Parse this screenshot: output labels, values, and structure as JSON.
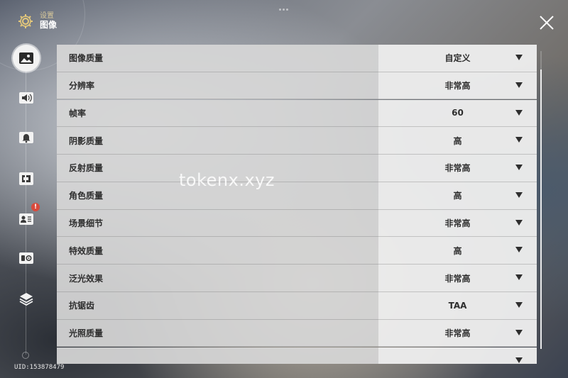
{
  "header": {
    "subtitle": "设置",
    "title": "图像",
    "settings_icon": "gear-icon"
  },
  "close_icon": "close-icon",
  "sidebar": {
    "items": [
      {
        "icon": "image-icon",
        "active": true
      },
      {
        "icon": "speaker-icon",
        "active": false
      },
      {
        "icon": "bell-icon",
        "active": false
      },
      {
        "icon": "controller-icon",
        "active": false
      },
      {
        "icon": "profile-card-icon",
        "active": false,
        "badge": "!"
      },
      {
        "icon": "gear-gamepad-icon",
        "active": false
      },
      {
        "icon": "layers-icon",
        "active": false
      }
    ]
  },
  "settings": [
    {
      "label": "图像质量",
      "value": "自定义"
    },
    {
      "label": "分辨率",
      "value": "非常高"
    },
    {
      "label": "帧率",
      "value": "60"
    },
    {
      "label": "阴影质量",
      "value": "高"
    },
    {
      "label": "反射质量",
      "value": "非常高"
    },
    {
      "label": "角色质量",
      "value": "高"
    },
    {
      "label": "场景细节",
      "value": "非常高"
    },
    {
      "label": "特效质量",
      "value": "高"
    },
    {
      "label": "泛光效果",
      "value": "非常高"
    },
    {
      "label": "抗锯齿",
      "value": "TAA"
    },
    {
      "label": "光照质量",
      "value": "非常高"
    },
    {
      "label": "",
      "value": ""
    }
  ],
  "uid": "UID:153878479",
  "watermark": "tokenx.xyz",
  "colors": {
    "accent_gold": "#d8c89a",
    "badge_red": "#d94a3c",
    "row_label_bg": "#d6d6d6",
    "row_value_bg": "#ececec"
  }
}
